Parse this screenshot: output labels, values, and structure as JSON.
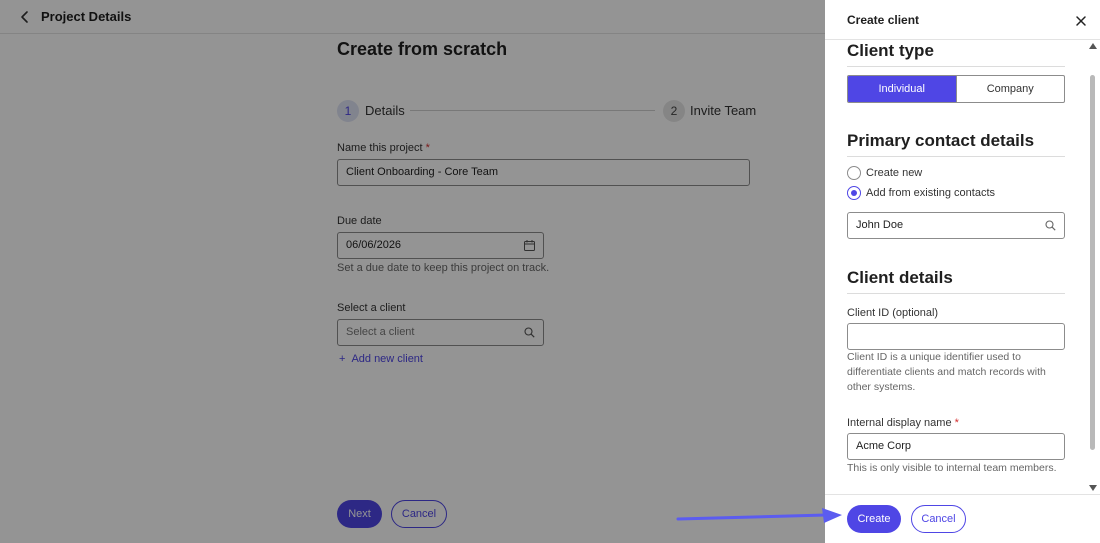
{
  "topbar": {
    "title": "Project Details"
  },
  "main": {
    "title": "Create from scratch",
    "steps": [
      {
        "number": "1",
        "label": "Details"
      },
      {
        "number": "2",
        "label": "Invite Team"
      }
    ],
    "name_field": {
      "label": "Name this project",
      "required_mark": "*",
      "value": "Client Onboarding - Core Team"
    },
    "due_date": {
      "label": "Due date",
      "value": "06/06/2026",
      "helper": "Set a due date to keep this project on track."
    },
    "client_field": {
      "label": "Select a client",
      "placeholder": "Select a client"
    },
    "add_client": {
      "icon": "+",
      "label": "Add new client"
    },
    "next_label": "Next",
    "cancel_label": "Cancel"
  },
  "drawer": {
    "title": "Create client",
    "client_type": {
      "heading": "Client type",
      "options": [
        "Individual",
        "Company"
      ],
      "selected": "Individual"
    },
    "primary_contact": {
      "heading": "Primary contact details",
      "options": [
        "Create new",
        "Add from existing contacts"
      ],
      "selected": "Add from existing contacts",
      "search_value": "John Doe"
    },
    "client_details": {
      "heading": "Client details",
      "client_id": {
        "label": "Client ID (optional)",
        "value": "",
        "helper": "Client ID is a unique identifier used to differentiate clients and match records with other systems."
      },
      "display_name": {
        "label": "Internal display name",
        "required_mark": "*",
        "value": "Acme Corp",
        "helper": "This is only visible to internal team members."
      }
    },
    "create_label": "Create",
    "cancel_label": "Cancel"
  },
  "colors": {
    "accent": "#4f46e5",
    "annotation_arrow": "#5b5cf0",
    "required": "#d32f2f"
  },
  "icons": [
    "chevron-left-icon",
    "calendar-icon",
    "search-icon",
    "plus-icon",
    "close-icon"
  ]
}
